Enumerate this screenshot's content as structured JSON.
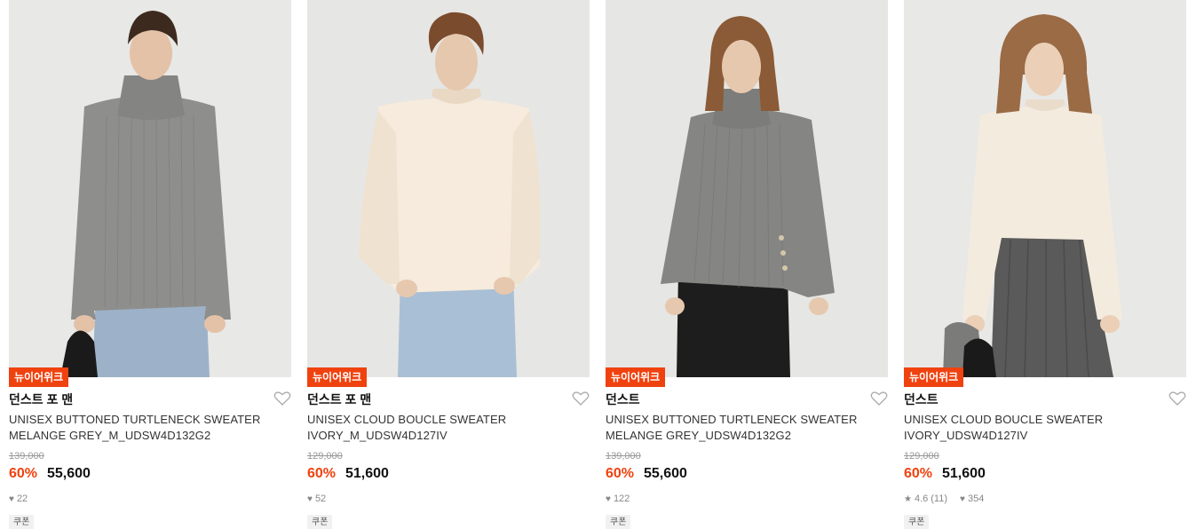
{
  "products": [
    {
      "badge": "뉴이어위크",
      "brand": "던스트 포 맨",
      "name_line1": "UNISEX BUTTONED TURTLENECK SWEATER",
      "name_line2": "MELANGE GREY_M_UDSW4D132G2",
      "original_price": "139,000",
      "discount": "60%",
      "price": "55,600",
      "rating": "",
      "review_count": "",
      "likes": "22",
      "coupon": "쿠폰",
      "image": {
        "sweater_color": "#8e8e8c",
        "pants_color": "#9db2c8",
        "style": "turtleneck"
      }
    },
    {
      "badge": "뉴이어위크",
      "brand": "던스트 포 맨",
      "name_line1": "UNISEX CLOUD BOUCLE SWEATER",
      "name_line2": "IVORY_M_UDSW4D127IV",
      "original_price": "129,000",
      "discount": "60%",
      "price": "51,600",
      "rating": "",
      "review_count": "",
      "likes": "52",
      "coupon": "쿠폰",
      "image": {
        "sweater_color": "#f6ebdc",
        "pants_color": "#a9bfd5",
        "style": "crew"
      }
    },
    {
      "badge": "뉴이어위크",
      "brand": "던스트",
      "name_line1": "UNISEX BUTTONED TURTLENECK SWEATER",
      "name_line2": "MELANGE GREY_UDSW4D132G2",
      "original_price": "139,000",
      "discount": "60%",
      "price": "55,600",
      "rating": "",
      "review_count": "",
      "likes": "122",
      "coupon": "쿠폰",
      "image": {
        "sweater_color": "#858583",
        "pants_color": "#1d1d1d",
        "style": "turtleneck"
      }
    },
    {
      "badge": "뉴이어위크",
      "brand": "던스트",
      "name_line1": "UNISEX CLOUD BOUCLE SWEATER",
      "name_line2": "IVORY_UDSW4D127IV",
      "original_price": "129,000",
      "discount": "60%",
      "price": "51,600",
      "rating": "4.6",
      "review_count": "(11)",
      "likes": "354",
      "coupon": "쿠폰",
      "image": {
        "sweater_color": "#f4ebdf",
        "pants_color": "#5a5a5a",
        "style": "crew"
      }
    }
  ],
  "colors": {
    "accent": "#f0420f",
    "muted": "#999999"
  }
}
